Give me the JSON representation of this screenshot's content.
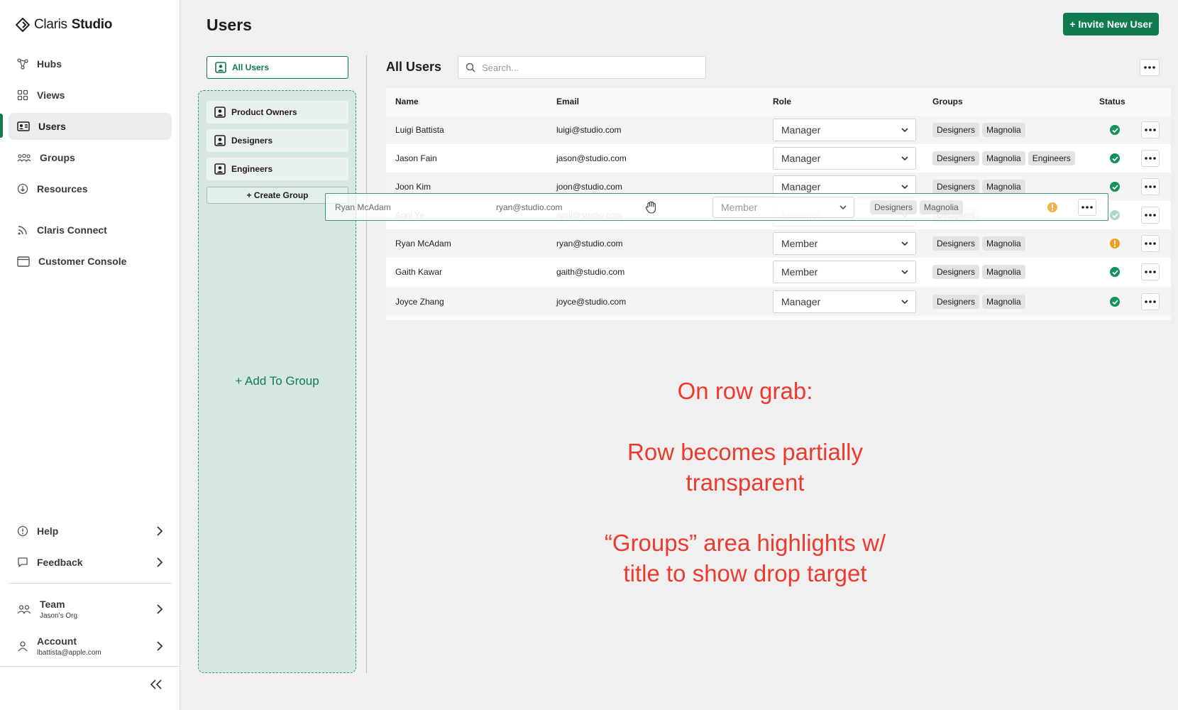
{
  "app": {
    "brand_light": "Claris",
    "brand_bold": "Studio"
  },
  "sidebar": {
    "items": [
      {
        "label": "Hubs",
        "icon": "hubs-icon"
      },
      {
        "label": "Views",
        "icon": "views-icon"
      },
      {
        "label": "Users",
        "icon": "users-card-icon",
        "active": true
      },
      {
        "label": "Groups",
        "icon": "groups-icon"
      },
      {
        "label": "Resources",
        "icon": "resources-icon"
      },
      {
        "label": "Claris Connect",
        "icon": "rss-icon"
      },
      {
        "label": "Customer Console",
        "icon": "console-window-icon"
      }
    ],
    "bottom": {
      "help": "Help",
      "feedback": "Feedback",
      "team": {
        "label": "Team",
        "sub": "Jason's Org"
      },
      "account": {
        "label": "Account",
        "sub": "lbattista@apple.com"
      }
    }
  },
  "header": {
    "title": "Users",
    "invite_label": "+ Invite New User"
  },
  "groups_panel": {
    "all_users": "All Users",
    "groups": [
      "Product Owners",
      "Designers",
      "Engineers"
    ],
    "create_group": "+ Create Group",
    "add_to_group": "+ Add To Group"
  },
  "main": {
    "section_title": "All Users",
    "search_placeholder": "Search...",
    "columns": [
      "Name",
      "Email",
      "Role",
      "Groups",
      "Status"
    ],
    "rows": [
      {
        "name": "Luigi Battista",
        "email": "luigi@studio.com",
        "role": "Manager",
        "groups": [
          "Designers",
          "Magnolia"
        ],
        "status": "ok"
      },
      {
        "name": "Jason Fain",
        "email": "jason@studio.com",
        "role": "Manager",
        "groups": [
          "Designers",
          "Magnolia",
          "Engineers"
        ],
        "status": "ok"
      },
      {
        "name": "Joon Kim",
        "email": "joon@studio.com",
        "role": "Manager",
        "groups": [
          "Designers",
          "Magnolia"
        ],
        "status": "ok"
      },
      {
        "name": "April Ye",
        "email": "april@studio.com",
        "role": "Manager",
        "groups": [
          "Designers"
        ],
        "status": "ok"
      },
      {
        "name": "Ryan McAdam",
        "email": "ryan@studio.com",
        "role": "Member",
        "groups": [
          "Designers",
          "Magnolia"
        ],
        "status": "warn"
      },
      {
        "name": "Gaith Kawar",
        "email": "gaith@studio.com",
        "role": "Member",
        "groups": [
          "Designers",
          "Magnolia"
        ],
        "status": "ok"
      },
      {
        "name": "Joyce Zhang",
        "email": "joyce@studio.com",
        "role": "Manager",
        "groups": [
          "Designers",
          "Magnolia"
        ],
        "status": "ok"
      }
    ],
    "dragged_row": {
      "name": "Ryan McAdam",
      "email": "ryan@studio.com",
      "role": "Member",
      "groups": [
        "Designers",
        "Magnolia"
      ],
      "status": "warn"
    }
  },
  "annotation": {
    "line1": "On row grab:",
    "line2": "Row becomes partially",
    "line3": "transparent",
    "line4": "“Groups” area highlights w/",
    "line5": "title to show drop target"
  },
  "colors": {
    "accent": "#0f7b4f",
    "ok": "#14925a",
    "warn": "#f0a020",
    "annotation": "#ee3a2e",
    "drop_zone": "#d5e7e0"
  }
}
